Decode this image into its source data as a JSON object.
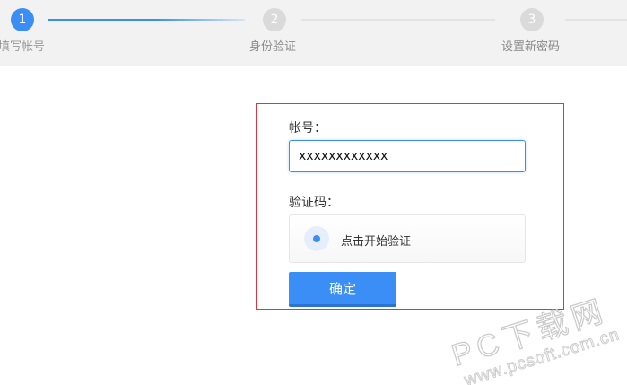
{
  "steps": [
    {
      "number": "1",
      "label": "填写帐号",
      "active": true
    },
    {
      "number": "2",
      "label": "身份验证",
      "active": false
    },
    {
      "number": "3",
      "label": "设置新密码",
      "active": false
    }
  ],
  "form": {
    "account_label": "帐号：",
    "account_value": "xxxxxxxxxxxx",
    "captcha_label": "验证码：",
    "captcha_text": "点击开始验证",
    "confirm_label": "确定"
  },
  "watermark": {
    "line1": "PC下载网",
    "line2": "www.pcsoft.com.cn"
  },
  "colors": {
    "accent": "#3a8ef6",
    "highlight_border": "#d9364a"
  }
}
